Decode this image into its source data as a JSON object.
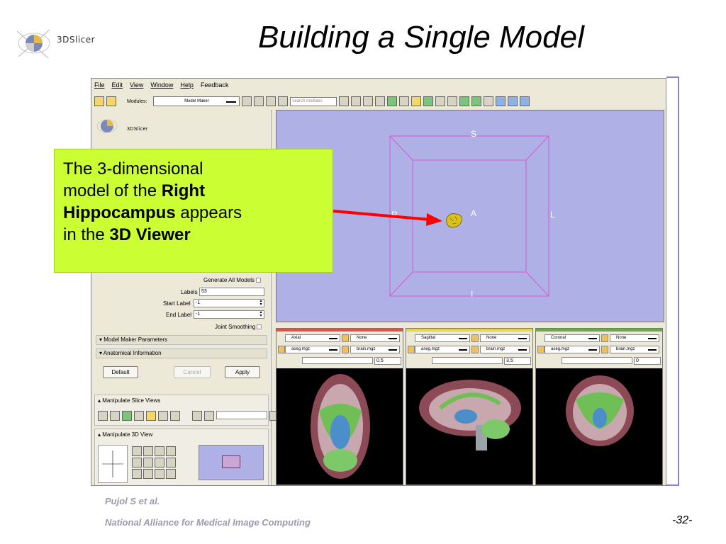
{
  "slide": {
    "title": "Building a Single Model",
    "logo_text": "3DSlicer",
    "footer_author": "Pujol S et al.",
    "footer_org": "National Alliance for Medical Image Computing",
    "page_number": "-32-"
  },
  "app": {
    "menu": [
      "File",
      "Edit",
      "View",
      "Window",
      "Help",
      "Feedback"
    ],
    "toolbar": {
      "modules_label": "Modules:",
      "module_selected": "Model Maker",
      "search_placeholder": "search modules"
    },
    "left_panel": {
      "logo_text": "3DSlicer",
      "generate_all_models_label": "Generate All Models",
      "labels_label": "Labels",
      "labels_value": "53",
      "start_label_label": "Start Label",
      "start_label_value": "-1",
      "end_label_label": "End Label",
      "end_label_value": "-1",
      "joint_smoothing_label": "Joint Smoothing",
      "section_model_maker_parameters": "Model Maker Parameters",
      "section_anatomical_information": "Anatomical Information",
      "default_button": "Default",
      "cancel_button": "Cancel",
      "apply_button": "Apply",
      "manipulate_slice_views": "Manipulate Slice Views",
      "manipulate_3d_view": "Manipulate 3D View"
    },
    "viewer3d": {
      "label_top": "S",
      "label_bottom": "I",
      "label_left": "R",
      "label_right": "L",
      "label_center": "A"
    },
    "slices": [
      {
        "orientation": "Axial",
        "foreground": "None",
        "label_volume": "aseg.mgz",
        "background": "brain.mgz",
        "offset": "0.5",
        "bar_color": "#d9534f"
      },
      {
        "orientation": "Sagittal",
        "foreground": "None",
        "label_volume": "aseg.mgz",
        "background": "brain.mgz",
        "offset": "3.5",
        "bar_color": "#e8d44d"
      },
      {
        "orientation": "Coronal",
        "foreground": "None",
        "label_volume": "aseg.mgz",
        "background": "brain.mgz",
        "offset": "0",
        "bar_color": "#6aa84f"
      }
    ]
  },
  "callout": {
    "line1": "The 3-dimensional",
    "line2_pre": "model of the ",
    "line2_bold": "Right",
    "line3_bold": "Hippocampus",
    "line3_post": " appears",
    "line4_pre": "in the ",
    "line4_bold": "3D Viewer",
    "background": "#ccff33"
  },
  "colors": {
    "viewer_background": "#afb0e6",
    "bounding_box": "#d65ad6",
    "arrow": "#ff0000",
    "footer_text": "#9a9ab0"
  }
}
